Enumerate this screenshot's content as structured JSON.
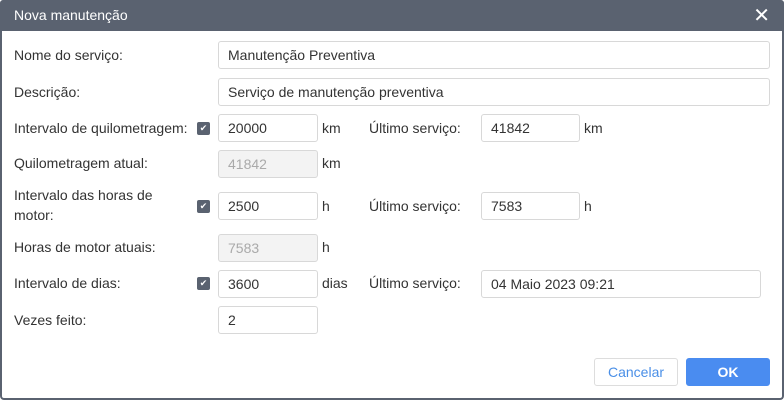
{
  "title": "Nova manutenção",
  "close": "✕",
  "fields": {
    "nome": {
      "label": "Nome do serviço:",
      "value": "Manutenção Preventiva"
    },
    "descricao": {
      "label": "Descrição:",
      "value": "Serviço de manutenção preventiva"
    },
    "km": {
      "label": "Intervalo de quilometragem:",
      "value": "20000",
      "unit": "km",
      "checked": true,
      "last_label": "Último serviço:",
      "last_value": "41842",
      "last_unit": "km"
    },
    "km_atual": {
      "label": "Quilometragem atual:",
      "value": "41842",
      "unit": "km"
    },
    "horas": {
      "label": "Intervalo das horas de motor:",
      "value": "2500",
      "unit": "h",
      "checked": true,
      "last_label": "Último serviço:",
      "last_value": "7583",
      "last_unit": "h"
    },
    "horas_atual": {
      "label": "Horas de motor atuais:",
      "value": "7583",
      "unit": "h"
    },
    "dias": {
      "label": "Intervalo de dias:",
      "value": "3600",
      "unit": "dias",
      "checked": true,
      "last_label": "Último serviço:",
      "last_value": "04 Maio 2023 09:21"
    },
    "vezes": {
      "label": "Vezes feito:",
      "value": "2"
    }
  },
  "check": "✔",
  "buttons": {
    "cancel": "Cancelar",
    "ok": "OK"
  }
}
